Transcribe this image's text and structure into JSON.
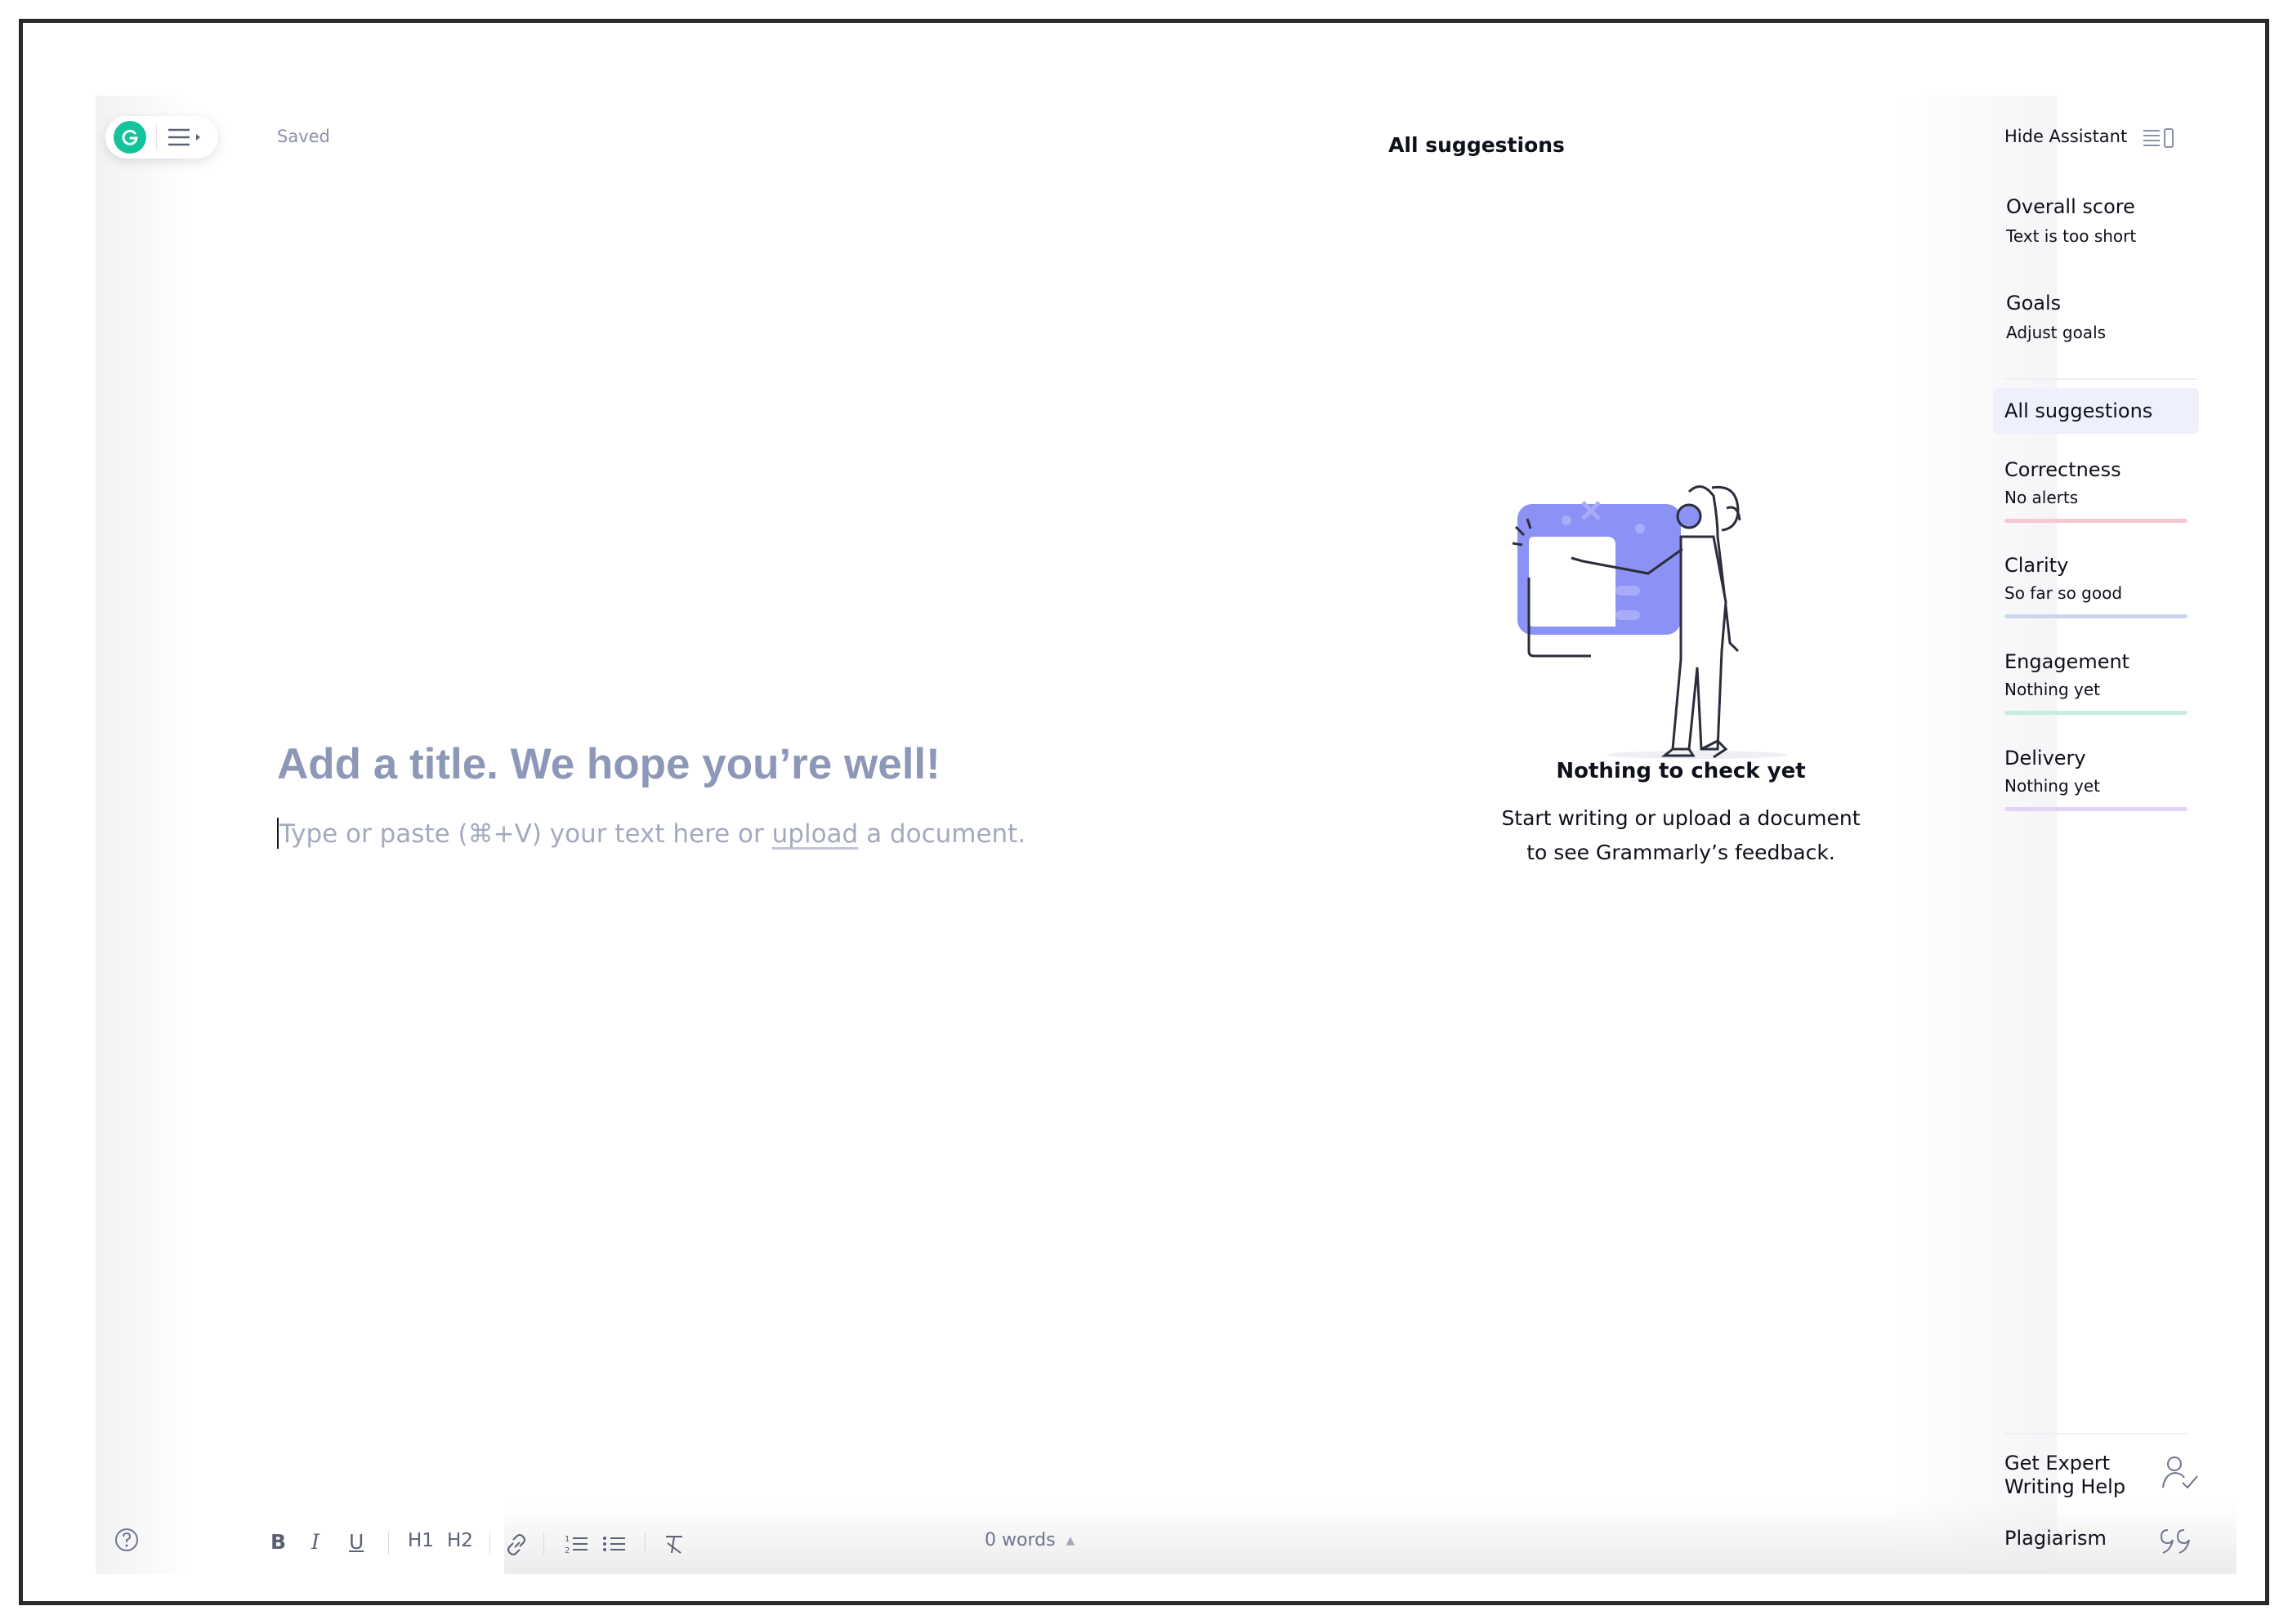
{
  "app": {
    "status": "Saved",
    "center_title": "All suggestions"
  },
  "editor": {
    "title_placeholder": "Add a title. We hope you’re well!",
    "body_before": "Type or paste (⌘+V) your text here or ",
    "body_link": "upload",
    "body_after": " a document."
  },
  "empty_state": {
    "heading": "Nothing to check yet",
    "line1": "Start writing or upload a document",
    "line2": "to see Grammarly’s feedback."
  },
  "sidebar": {
    "hide_assistant": "Hide Assistant",
    "overall_score": {
      "title": "Overall score",
      "subtitle": "Text is too short"
    },
    "goals": {
      "title": "Goals",
      "subtitle": "Adjust goals"
    },
    "all_suggestions": "All suggestions",
    "categories": [
      {
        "title": "Correctness",
        "subtitle": "No alerts",
        "color": "#f7c8d2"
      },
      {
        "title": "Clarity",
        "subtitle": "So far so good",
        "color": "#c9d8ef"
      },
      {
        "title": "Engagement",
        "subtitle": "Nothing yet",
        "color": "#c5ecde"
      },
      {
        "title": "Delivery",
        "subtitle": "Nothing yet",
        "color": "#e4d3f5"
      }
    ],
    "expert_line1": "Get Expert",
    "expert_line2": "Writing Help",
    "plagiarism": "Plagiarism"
  },
  "toolbar": {
    "bold": "B",
    "italic": "I",
    "underline": "U",
    "h1": "H1",
    "h2": "H2",
    "word_count": "0 words"
  },
  "colors": {
    "brand": "#15c39a",
    "illustration_accent": "#8c91f5",
    "placeholder": "#8d98b8"
  }
}
